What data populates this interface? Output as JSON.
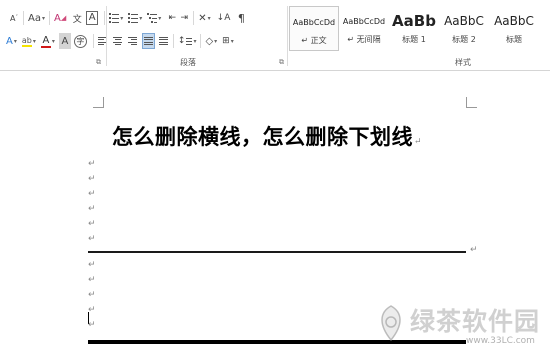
{
  "ribbon": {
    "font_group": {
      "grow_font": "A",
      "change_case": "Aa",
      "clear_format": "A",
      "char_border": "A",
      "text_effects": "A",
      "highlight": "ab",
      "font_color": "A",
      "char_shading": "A",
      "enclose_char": "字"
    },
    "paragraph_group": {
      "label": "段落"
    },
    "styles_group": {
      "label": "样式",
      "items": [
        {
          "sample": "AaBbCcDd",
          "name": "↵ 正文"
        },
        {
          "sample": "AaBbCcDd",
          "name": "↵ 无间隔"
        },
        {
          "sample": "AaBb",
          "name": "标题 1"
        },
        {
          "sample": "AaBbC",
          "name": "标题 2"
        },
        {
          "sample": "AaBbC",
          "name": "标题"
        }
      ]
    },
    "colors": {
      "highlight": "#f5e400",
      "font_color": "#d01818",
      "accent": "#2b579a"
    }
  },
  "document": {
    "title": "怎么删除横线，怎么删除下划线",
    "paragraph_mark": "↵"
  },
  "watermark": {
    "text": "绿茶软件园",
    "url": "www.33LC.com"
  }
}
